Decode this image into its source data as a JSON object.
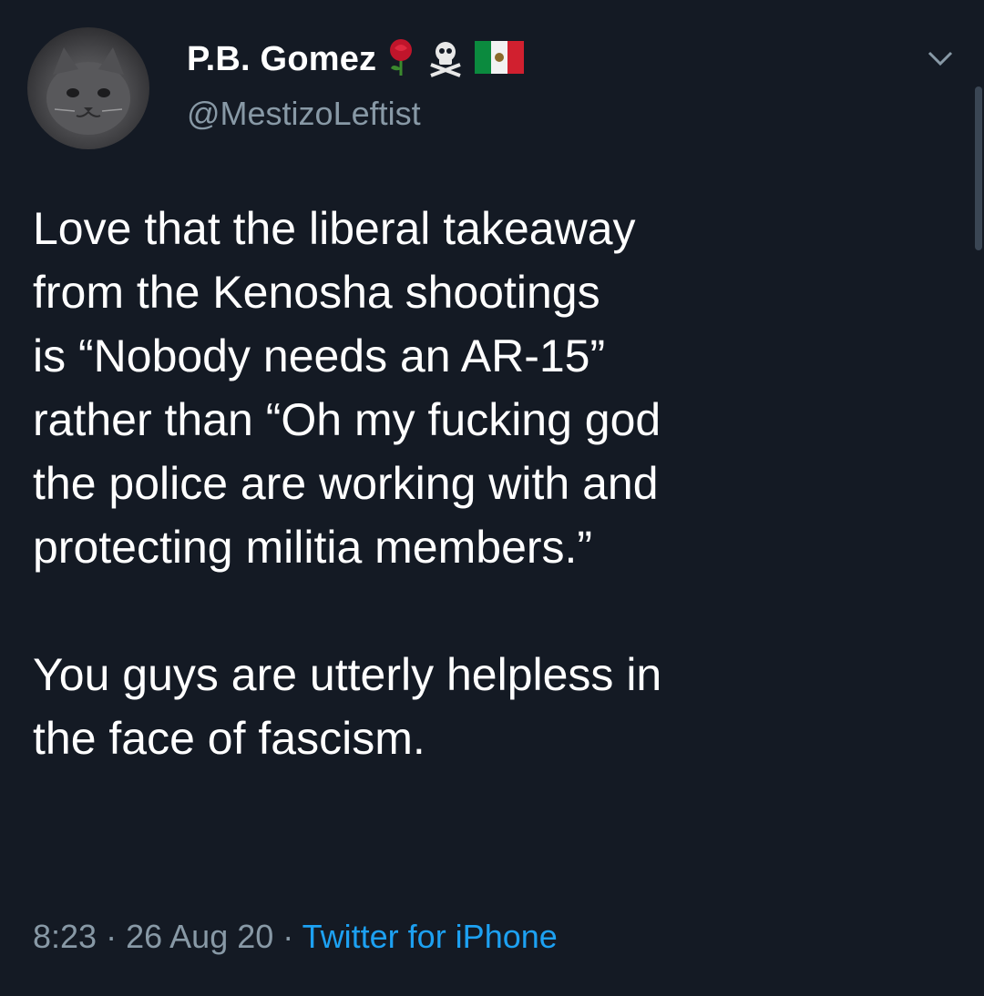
{
  "tweet": {
    "display_name": "P.B. Gomez",
    "handle": "@MestizoLeftist",
    "name_emojis": [
      "rose-icon",
      "skull-crossbones-icon",
      "mexico-flag-icon"
    ],
    "text": "Love that the liberal takeaway\nfrom the Kenosha shootings\nis “Nobody needs an AR-15”\nrather than “Oh my fucking god\nthe police are working with and\nprotecting militia members.”\n\nYou guys are utterly helpless in\nthe face of fascism.",
    "time": "8:23",
    "separator": "·",
    "date": "26 Aug 20",
    "source": "Twitter for iPhone"
  },
  "colors": {
    "background": "#141a24",
    "text": "#ffffff",
    "secondary": "#8899a6",
    "link": "#1da1f2"
  }
}
